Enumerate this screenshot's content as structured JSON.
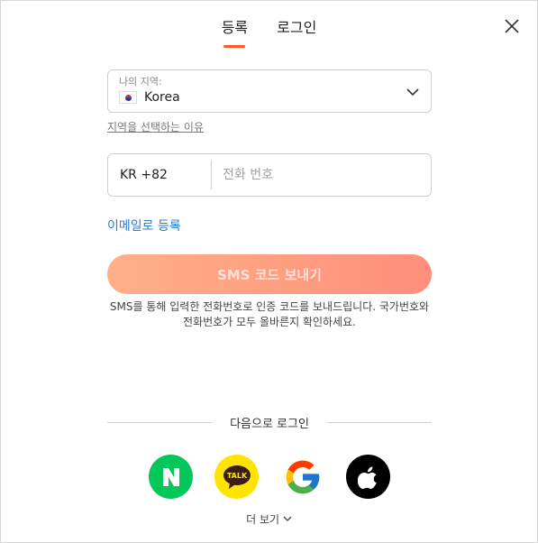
{
  "tabs": [
    {
      "label": "등록",
      "active": true
    },
    {
      "label": "로그인",
      "active": false
    }
  ],
  "region": {
    "label": "나의 지역:",
    "value": "Korea",
    "why_link": "지역을 선택하는 이유"
  },
  "phone": {
    "country_code": "KR +82",
    "placeholder": "전화 번호"
  },
  "email_link": "이메일로 등록",
  "sms_button": "SMS 코드 보내기",
  "notice": "SMS를 통해 입력한 전화번호로 인증 코드를 보내드립니다. 국가번호와 전화번호가 모두 올바른지 확인하세요.",
  "social": {
    "divider_text": "다음으로 로그인",
    "providers": [
      {
        "name": "naver",
        "glyph": "N"
      },
      {
        "name": "kakao",
        "glyph": "TALK"
      },
      {
        "name": "google",
        "glyph": "G"
      },
      {
        "name": "apple",
        "glyph": "apple"
      }
    ]
  },
  "more": "더 보기",
  "colors": {
    "accent": "#ff5a1f",
    "link": "#2b7bd1",
    "naver": "#03c75a",
    "kakao": "#fee500"
  }
}
